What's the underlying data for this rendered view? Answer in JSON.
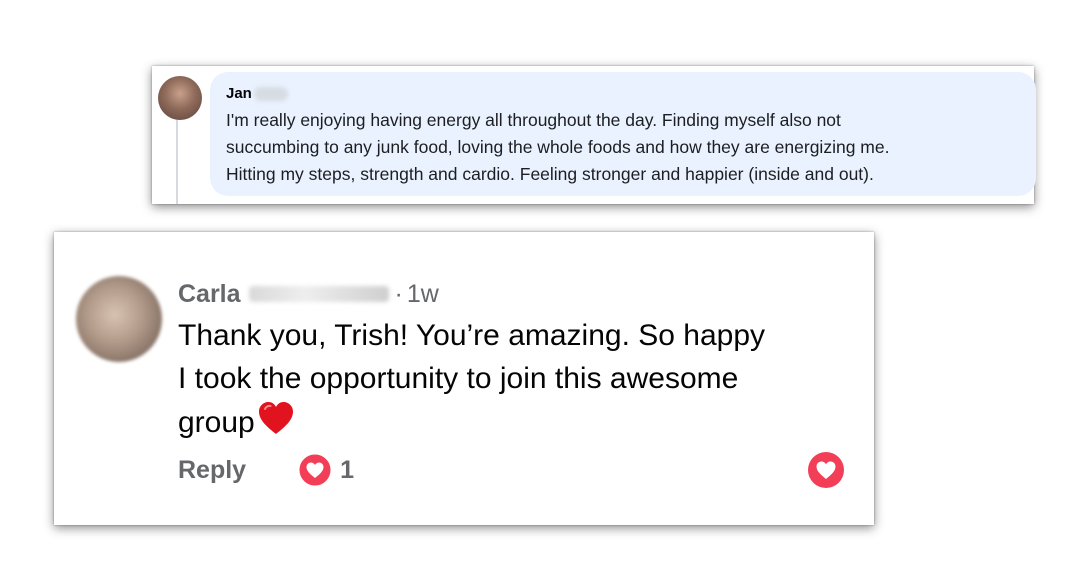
{
  "comments": [
    {
      "author": "Jan",
      "text": "I'm really enjoying having energy all throughout the day. Finding myself also not\nsuccumbing to any junk food, loving the whole foods and how they are energizing me.\nHitting my steps, strength and cardio. Feeling stronger and happier (inside and out)."
    },
    {
      "author": "Carla",
      "separator": "·",
      "time": "1w",
      "text": "Thank you, Trish!   You’re amazing.   So happy\nI took the opportunity to join this    awesome\ngroup",
      "reply_label": "Reply",
      "reaction_count": "1",
      "reaction_icon": "love-reaction-icon"
    }
  ],
  "colors": {
    "bubble_bg": "#e9f2fe",
    "meta_text": "#65676b",
    "love_red": "#f33e58",
    "emoji_red": "#e0131f"
  }
}
